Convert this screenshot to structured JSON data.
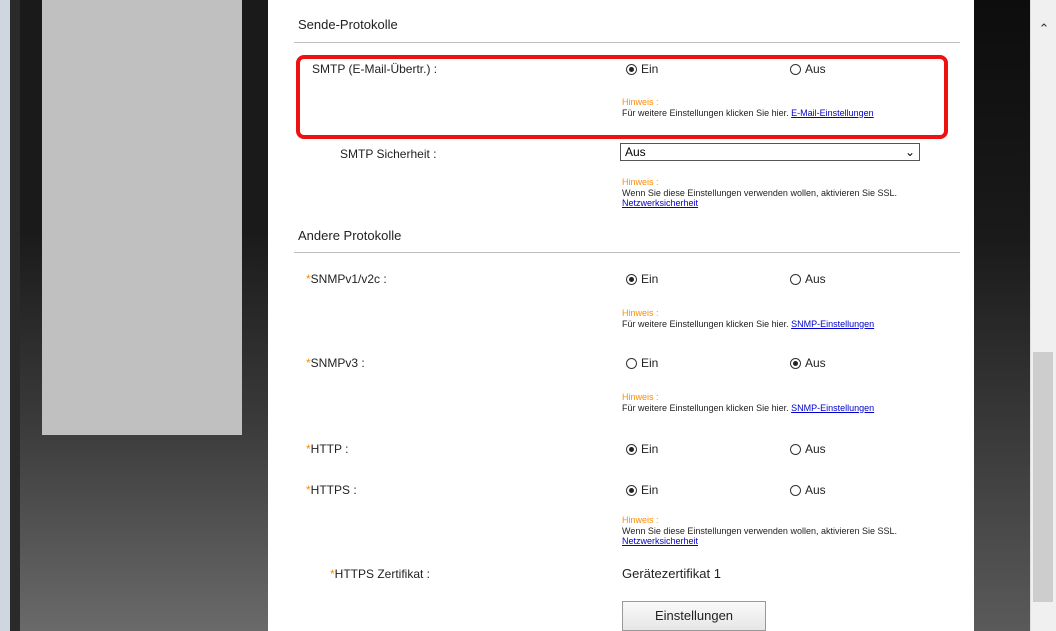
{
  "send_protocols": {
    "title": "Sende-Protokolle",
    "smtp": {
      "label": "SMTP (E-Mail-Übertr.) :",
      "on": "Ein",
      "off": "Aus",
      "selected": "on",
      "hint_title": "Hinweis :",
      "hint_text": "Für weitere Einstellungen klicken Sie hier.",
      "hint_link": "E-Mail-Einstellungen"
    },
    "smtp_security": {
      "label": "SMTP Sicherheit :",
      "value": "Aus",
      "hint_title": "Hinweis :",
      "hint_text": "Wenn Sie diese Einstellungen verwenden wollen, aktivieren Sie SSL.",
      "hint_link": "Netzwerksicherheit"
    }
  },
  "other_protocols": {
    "title": "Andere Protokolle",
    "snmpv1": {
      "required": "*",
      "label": "SNMPv1/v2c :",
      "on": "Ein",
      "off": "Aus",
      "selected": "on",
      "hint_title": "Hinweis :",
      "hint_text": "Für weitere Einstellungen klicken Sie hier.",
      "hint_link": "SNMP-Einstellungen"
    },
    "snmpv3": {
      "required": "*",
      "label": "SNMPv3 :",
      "on": "Ein",
      "off": "Aus",
      "selected": "off",
      "hint_title": "Hinweis :",
      "hint_text": "Für weitere Einstellungen klicken Sie hier.",
      "hint_link": "SNMP-Einstellungen"
    },
    "http": {
      "required": "*",
      "label": "HTTP :",
      "on": "Ein",
      "off": "Aus",
      "selected": "on"
    },
    "https": {
      "required": "*",
      "label": "HTTPS :",
      "on": "Ein",
      "off": "Aus",
      "selected": "on",
      "hint_title": "Hinweis :",
      "hint_text": "Wenn Sie diese Einstellungen verwenden wollen, aktivieren Sie SSL.",
      "hint_link": "Netzwerksicherheit"
    },
    "https_cert": {
      "required": "*",
      "label": "HTTPS Zertifikat :",
      "value": "Gerätezertifikat 1",
      "button": "Einstellungen"
    }
  },
  "colors": {
    "highlight": "#ee1111",
    "hint": "#ff8c00",
    "link": "#0000cc"
  },
  "icons": {
    "scroll_up": "chevron-up-icon",
    "select_arrow": "chevron-down-icon"
  }
}
